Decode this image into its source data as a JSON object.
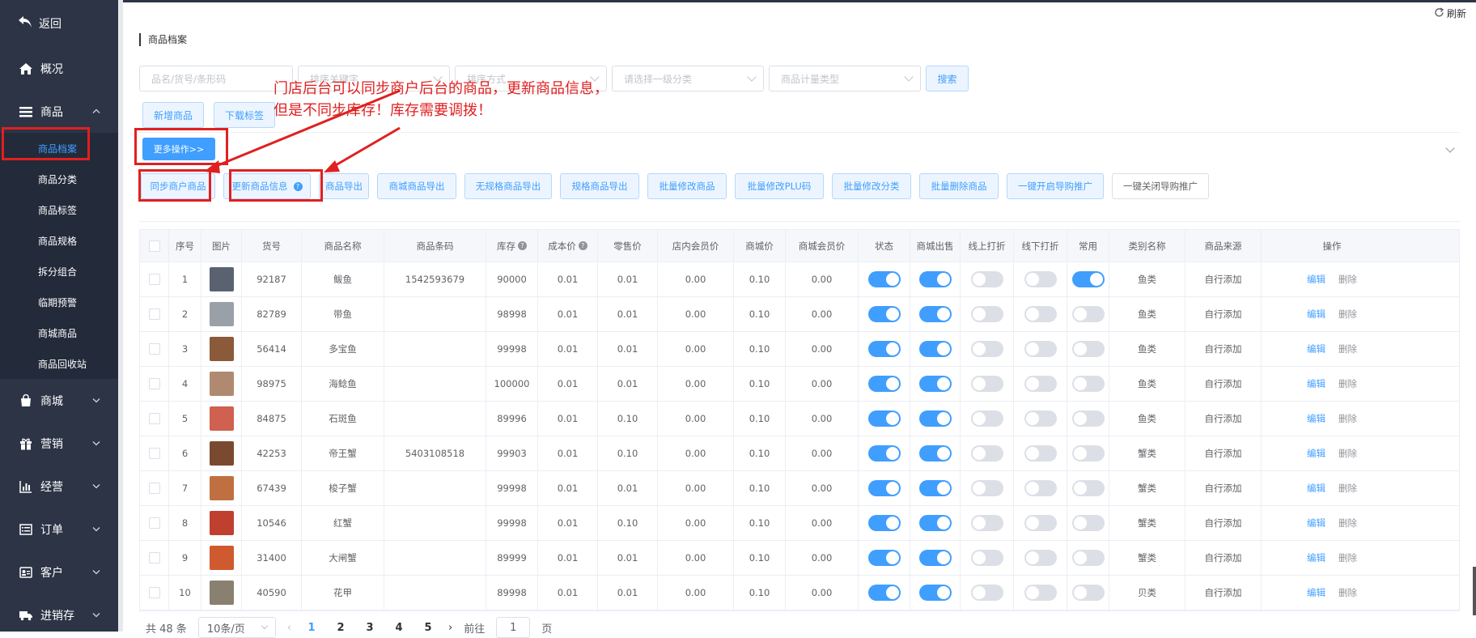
{
  "sidebar": {
    "back_label": "返回",
    "items": [
      {
        "label": "概况",
        "icon": "home-icon"
      },
      {
        "label": "商品",
        "icon": "list-icon"
      }
    ],
    "goods_sub": [
      "商品档案",
      "商品分类",
      "商品标签",
      "商品规格",
      "拆分组合",
      "临期预警",
      "商城商品",
      "商品回收站"
    ],
    "bottom_items": [
      {
        "label": "商城",
        "icon": "bag-icon"
      },
      {
        "label": "营销",
        "icon": "gift-icon"
      },
      {
        "label": "经营",
        "icon": "bar-chart-icon"
      },
      {
        "label": "订单",
        "icon": "order-list-icon"
      },
      {
        "label": "客户",
        "icon": "id-card-icon"
      },
      {
        "label": "进销存",
        "icon": "truck-icon"
      }
    ]
  },
  "header": {
    "refresh_label": "刷新",
    "page_title": "商品档案"
  },
  "filters": {
    "name_placeholder": "品名/货号/条形码",
    "sort_key_placeholder": "排序关键字",
    "sort_order_placeholder": "排序方式",
    "category_placeholder": "请选择一级分类",
    "unit_type_placeholder": "商品计量类型",
    "search_label": "搜索"
  },
  "actions": {
    "add_label": "新增商品",
    "download_label": "下载标签",
    "more_label": "更多操作>>",
    "ops": [
      "同步商户商品",
      "更新商品信息",
      "商品导出",
      "商城商品导出",
      "无规格商品导出",
      "规格商品导出",
      "批量修改商品",
      "批量修改PLU码",
      "批量修改分类",
      "批量删除商品",
      "一键开启导购推广"
    ],
    "close_promo_label": "一键关闭导购推广"
  },
  "annotation": {
    "line1": "门店后台可以同步商户后台的商品，更新商品信息，",
    "line2": "但是不同步库存！库存需要调拨！"
  },
  "table": {
    "headers": [
      "序号",
      "图片",
      "货号",
      "商品名称",
      "商品条码",
      "库存",
      "成本价",
      "零售价",
      "店内会员价",
      "商城价",
      "商城会员价",
      "状态",
      "商城出售",
      "线上打折",
      "线下打折",
      "常用",
      "类别名称",
      "商品来源",
      "操作"
    ],
    "edit_label": "编辑",
    "delete_label": "删除",
    "rows": [
      {
        "no": "1",
        "sku": "92187",
        "name": "鲅鱼",
        "barcode": "1542593679",
        "stock": "90000",
        "cost": "0.01",
        "retail": "0.01",
        "member": "0.00",
        "mall": "0.10",
        "mall_member": "0.00",
        "status": true,
        "mall_sale": true,
        "online_disc": false,
        "offline_disc": false,
        "common": true,
        "category": "鱼类",
        "source": "自行添加",
        "img_color": "#5a6272"
      },
      {
        "no": "2",
        "sku": "82789",
        "name": "带鱼",
        "barcode": "",
        "stock": "98998",
        "cost": "0.01",
        "retail": "0.01",
        "member": "0.00",
        "mall": "0.10",
        "mall_member": "0.00",
        "status": true,
        "mall_sale": true,
        "online_disc": false,
        "offline_disc": false,
        "common": false,
        "category": "鱼类",
        "source": "自行添加",
        "img_color": "#9aa0a8"
      },
      {
        "no": "3",
        "sku": "56414",
        "name": "多宝鱼",
        "barcode": "",
        "stock": "99998",
        "cost": "0.01",
        "retail": "0.01",
        "member": "0.00",
        "mall": "0.10",
        "mall_member": "0.00",
        "status": true,
        "mall_sale": true,
        "online_disc": false,
        "offline_disc": false,
        "common": false,
        "category": "鱼类",
        "source": "自行添加",
        "img_color": "#8a5a3a"
      },
      {
        "no": "4",
        "sku": "98975",
        "name": "海鲶鱼",
        "barcode": "",
        "stock": "100000",
        "cost": "0.01",
        "retail": "0.01",
        "member": "0.00",
        "mall": "0.10",
        "mall_member": "0.00",
        "status": true,
        "mall_sale": true,
        "online_disc": false,
        "offline_disc": false,
        "common": false,
        "category": "鱼类",
        "source": "自行添加",
        "img_color": "#b08a70"
      },
      {
        "no": "5",
        "sku": "84875",
        "name": "石斑鱼",
        "barcode": "",
        "stock": "89996",
        "cost": "0.01",
        "retail": "0.10",
        "member": "0.00",
        "mall": "0.10",
        "mall_member": "0.00",
        "status": true,
        "mall_sale": true,
        "online_disc": false,
        "offline_disc": false,
        "common": false,
        "category": "鱼类",
        "source": "自行添加",
        "img_color": "#d06050"
      },
      {
        "no": "6",
        "sku": "42253",
        "name": "帝王蟹",
        "barcode": "5403108518",
        "stock": "99903",
        "cost": "0.01",
        "retail": "0.10",
        "member": "0.00",
        "mall": "0.10",
        "mall_member": "0.00",
        "status": true,
        "mall_sale": true,
        "online_disc": false,
        "offline_disc": false,
        "common": false,
        "category": "蟹类",
        "source": "自行添加",
        "img_color": "#7a4a30"
      },
      {
        "no": "7",
        "sku": "67439",
        "name": "梭子蟹",
        "barcode": "",
        "stock": "99998",
        "cost": "0.01",
        "retail": "0.01",
        "member": "0.00",
        "mall": "0.10",
        "mall_member": "0.00",
        "status": true,
        "mall_sale": true,
        "online_disc": false,
        "offline_disc": false,
        "common": false,
        "category": "蟹类",
        "source": "自行添加",
        "img_color": "#c07040"
      },
      {
        "no": "8",
        "sku": "10546",
        "name": "红蟹",
        "barcode": "",
        "stock": "99998",
        "cost": "0.01",
        "retail": "0.10",
        "member": "0.00",
        "mall": "0.10",
        "mall_member": "0.00",
        "status": true,
        "mall_sale": true,
        "online_disc": false,
        "offline_disc": false,
        "common": false,
        "category": "蟹类",
        "source": "自行添加",
        "img_color": "#c04030"
      },
      {
        "no": "9",
        "sku": "31400",
        "name": "大闸蟹",
        "barcode": "",
        "stock": "89999",
        "cost": "0.01",
        "retail": "0.01",
        "member": "0.00",
        "mall": "0.10",
        "mall_member": "0.00",
        "status": true,
        "mall_sale": true,
        "online_disc": false,
        "offline_disc": false,
        "common": false,
        "category": "蟹类",
        "source": "自行添加",
        "img_color": "#d05a30"
      },
      {
        "no": "10",
        "sku": "40590",
        "name": "花甲",
        "barcode": "",
        "stock": "89998",
        "cost": "0.01",
        "retail": "0.01",
        "member": "0.00",
        "mall": "0.10",
        "mall_member": "0.00",
        "status": true,
        "mall_sale": true,
        "online_disc": false,
        "offline_disc": false,
        "common": false,
        "category": "贝类",
        "source": "自行添加",
        "img_color": "#8a8070"
      }
    ]
  },
  "pagination": {
    "total_label": "共 48 条",
    "page_size": "10条/页",
    "pages": [
      "1",
      "2",
      "3",
      "4",
      "5"
    ],
    "active_page": "1",
    "goto_label": "前往",
    "goto_value": "1",
    "page_suffix": "页"
  }
}
